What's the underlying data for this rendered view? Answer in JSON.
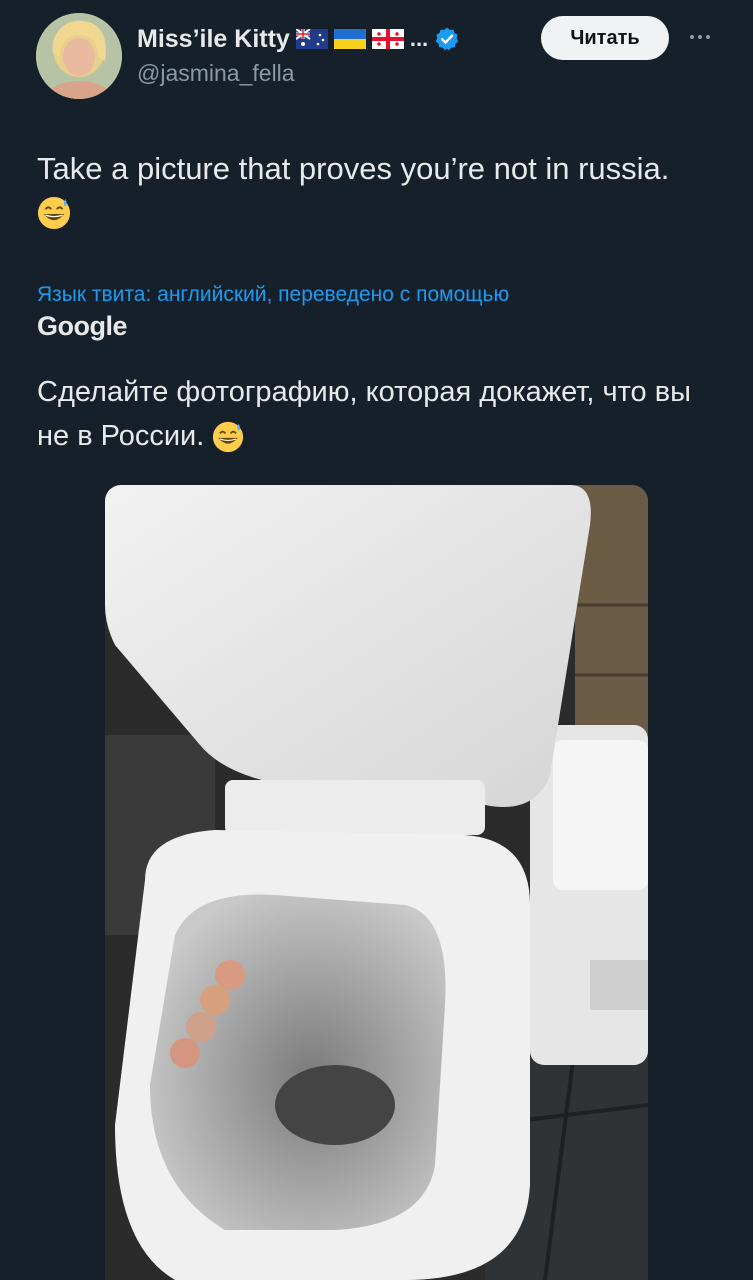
{
  "author": {
    "name": "Miss’ile Kitty",
    "name_suffix": "...",
    "handle": "@jasmina_fella",
    "flags": [
      "australia-flag",
      "ukraine-flag",
      "georgia-flag"
    ],
    "verified_color": "#1d9bf0"
  },
  "actions": {
    "follow_label": "Читать"
  },
  "tweet": {
    "text": "Take a picture that proves you’re not in russia.",
    "emoji": "sweat-smile-emoji"
  },
  "translation": {
    "note": "Язык твита: английский, переведено с помощью",
    "provider": "Google",
    "text": "Сделайте фотографию, которая докажет, что вы не в России."
  },
  "media": {
    "type": "photo",
    "subject": "toilet-photo"
  },
  "colors": {
    "background": "#15202b",
    "text": "#e7e9ea",
    "secondary": "#8b98a5",
    "link": "#1d9bf0",
    "button_bg": "#eff3f4"
  }
}
